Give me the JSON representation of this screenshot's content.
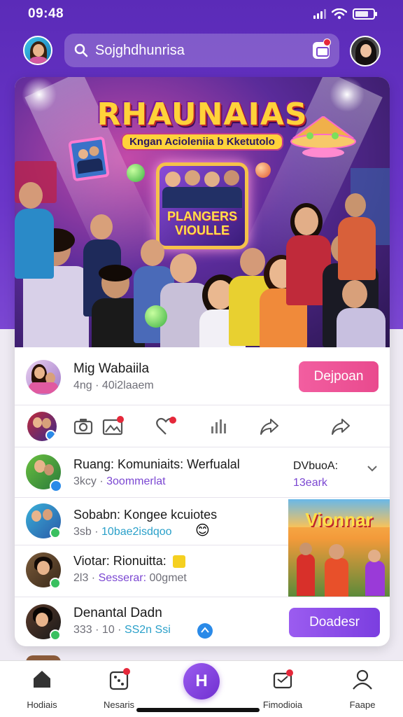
{
  "status_bar": {
    "time": "09:48"
  },
  "header": {
    "search": {
      "placeholder": "Sojghdhunrisa"
    }
  },
  "banner": {
    "title": "RHAUNAIAS",
    "subtitle": "Kngan Acioleniia b Kketutolo",
    "tv_text_line1": "PLANGERS",
    "tv_text_line2": "VIOULLE"
  },
  "host": {
    "name": "Mig Wabaiila",
    "meta": "4ng · 40i2laaem",
    "button_label": "Dejpoan"
  },
  "actions": [
    "camera-icon",
    "gallery-icon",
    "heart-icon",
    "music-icon",
    "share-icon",
    "forward-icon"
  ],
  "feed": [
    {
      "title": "Ruang: Komuniaits: Werfualal",
      "meta_prefix": "3kcy · ",
      "meta_accent": "3oommerlat",
      "side_top": "DVbuoA:",
      "side_bottom": "13eark"
    },
    {
      "title": "Sobabn: Kongee kcuiotes",
      "meta_prefix": "3sb · ",
      "meta_accent": "10bae2isdqoo",
      "emoji": "😊"
    },
    {
      "title": "Viotar: Rionuitta:",
      "meta_prefix": "2l3 · ",
      "meta_accent": "Sesserar:",
      "meta_suffix": " 00gmet",
      "thumb_title": "Vionnar"
    },
    {
      "title": "Denantal Dadn",
      "meta_prefix": "333 · 10 · ",
      "meta_accent": "SS2n Ssi",
      "button_label": "Doadesr"
    }
  ],
  "tabbar": {
    "items": [
      {
        "label": "Hodiais",
        "icon": "home-icon"
      },
      {
        "label": "Nesaris",
        "icon": "dice-icon"
      },
      {
        "label": "H",
        "icon": "create-icon"
      },
      {
        "label": "Fimodioia",
        "icon": "inbox-icon"
      },
      {
        "label": "Faape",
        "icon": "profile-icon"
      }
    ]
  },
  "colors": {
    "accent": "#7b47d2",
    "pink_button": "#f25ea0",
    "purple_button": "#8f4fee",
    "badge_red": "#e5283a"
  }
}
